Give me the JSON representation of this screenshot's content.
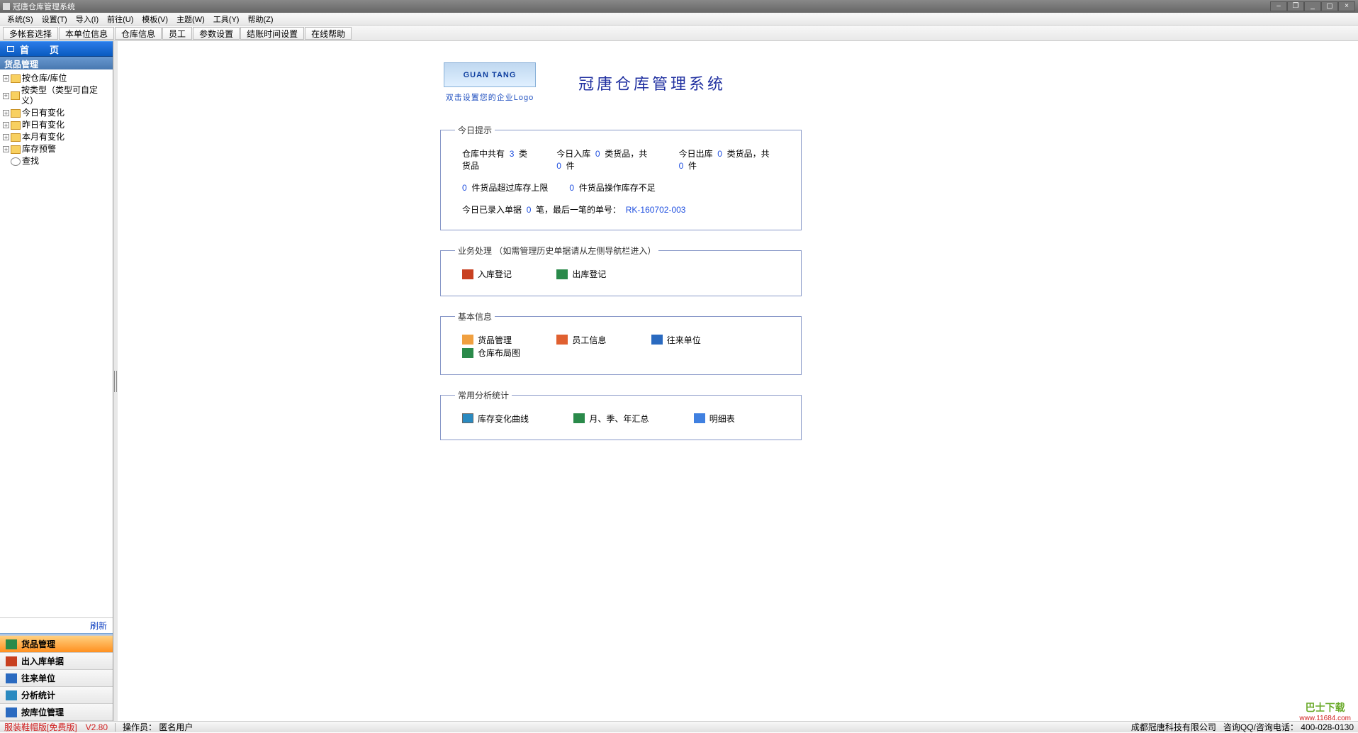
{
  "window": {
    "title": "冠唐仓库管理系统"
  },
  "menubar": [
    "系统(S)",
    "设置(T)",
    "导入(I)",
    "前往(U)",
    "模板(V)",
    "主题(W)",
    "工具(Y)",
    "帮助(Z)"
  ],
  "toolbar": [
    "多帐套选择",
    "本单位信息",
    "仓库信息",
    "员工",
    "参数设置",
    "结账时间设置",
    "在线帮助"
  ],
  "sidebar": {
    "home_tab": "首　页",
    "nav_header": "货品管理",
    "tree": [
      {
        "label": "按仓库/库位",
        "expand": true
      },
      {
        "label": "按类型（类型可自定义）",
        "expand": true
      },
      {
        "label": "今日有变化",
        "expand": true
      },
      {
        "label": "昨日有变化",
        "expand": true
      },
      {
        "label": "本月有变化",
        "expand": true
      },
      {
        "label": "库存预警",
        "expand": true
      },
      {
        "label": "查找",
        "expand": false,
        "search": true
      }
    ],
    "refresh": "刷新",
    "groups": [
      "货品管理",
      "出入库单据",
      "往来单位",
      "分析统计",
      "按库位管理"
    ]
  },
  "content": {
    "logo_text": "GUAN TANG",
    "logo_caption": "双击设置您的企业Logo",
    "system_title": "冠唐仓库管理系统",
    "tips": {
      "legend": "今日提示",
      "line1_a": "仓库中共有",
      "line1_a_num": "3",
      "line1_a_suffix": "类货品",
      "line1_b": "今日入库",
      "line1_b_num": "0",
      "line1_b_mid": "类货品，共",
      "line1_b_num2": "0",
      "line1_b_suffix": "件",
      "line1_c": "今日出库",
      "line1_c_num": "0",
      "line1_c_mid": "类货品，共",
      "line1_c_num2": "0",
      "line1_c_suffix": "件",
      "line2_a_num": "0",
      "line2_a": "件货品超过库存上限",
      "line2_b_num": "0",
      "line2_b": "件货品操作库存不足",
      "line3_a": "今日已录入单据",
      "line3_num": "0",
      "line3_b": "笔，最后一笔的单号：",
      "line3_order": "RK-160702-003"
    },
    "business": {
      "legend": "业务处理 （如需管理历史单据请从左侧导航栏进入）",
      "items": [
        "入库登记",
        "出库登记"
      ]
    },
    "basic": {
      "legend": "基本信息",
      "items": [
        "货品管理",
        "员工信息",
        "往来单位",
        "仓库布局图"
      ]
    },
    "stats": {
      "legend": "常用分析统计",
      "items": [
        "库存变化曲线",
        "月、季、年汇总",
        "明细表"
      ]
    }
  },
  "statusbar": {
    "version": "服装鞋帽版[免费版]　V2.80",
    "operator_label": "操作员：",
    "operator": "匿名用户",
    "company": "成都冠唐科技有限公司",
    "contact_label": "咨询QQ/咨询电话：",
    "contact": "400-028-0130"
  },
  "watermark": {
    "top": "巴士下载",
    "url": "www.11684.com"
  }
}
